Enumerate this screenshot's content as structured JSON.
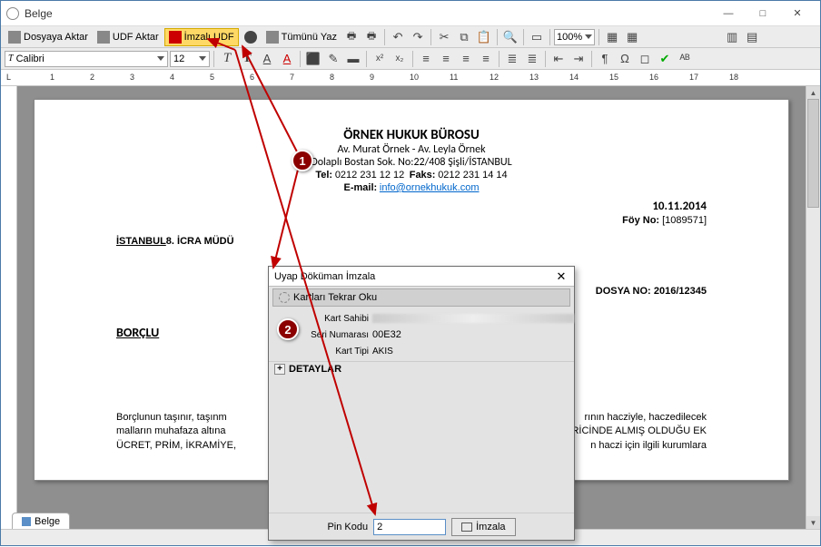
{
  "window": {
    "title": "Belge"
  },
  "toolbar": {
    "dosyaya_aktar": "Dosyaya Aktar",
    "udf_aktar": "UDF Aktar",
    "imzali_udf": "İmzalı UDF",
    "tumunu_yaz": "Tümünü Yaz",
    "zoom": "100%"
  },
  "font": {
    "name": "Calibri",
    "size": "12"
  },
  "doc": {
    "header": {
      "firm": "ÖRNEK HUKUK BÜROSU",
      "lawyers": "Av. Murat Örnek - Av. Leyla Örnek",
      "address": "Dolaplı Bostan Sok. No:22/408 Şişli/İSTANBUL",
      "tel_label": "Tel:",
      "tel": "0212 231 12 12",
      "fax_label": "Faks:",
      "fax": "0212 231 14 14",
      "email_label": "E-mail:",
      "email": "info@ornekhukuk.com"
    },
    "date": "10.11.2014",
    "foy_label": "Föy No:",
    "foy_no": "[1089571]",
    "court_pre": "İSTANBUL",
    "court_rest": "8. İCRA MÜDÜ",
    "dosya_label": "DOSYA NO:",
    "dosya_no": "2016/12345",
    "borclu": "BORÇLU",
    "body_l": "Borçlunun taşınır, taşınm",
    "body_r1": "rının hacziyle, haczedilecek",
    "body_l2": "malların muhafaza altına",
    "body_r2": "RİCİNDE ALMIŞ OLDUĞU EK",
    "body_l3": "ÜCRET, PRİM, İKRAMİYE,",
    "body_r3": "n haczi için ilgili kurumlara"
  },
  "dialog": {
    "title": "Uyap Döküman İmzala",
    "reread": "Kartları Tekrar Oku",
    "owner_label": "Kart Sahibi",
    "serial_label": "Seri Numarası",
    "serial_value": "00E32",
    "type_label": "Kart Tipi",
    "type_value": "AKIS",
    "details": "DETAYLAR",
    "pin_label": "Pin Kodu",
    "pin_value": "2",
    "sign": "İmzala"
  },
  "tab": {
    "label": "Belge"
  },
  "callouts": {
    "c1": "1",
    "c2": "2"
  },
  "ruler": [
    "1",
    "2",
    "3",
    "4",
    "5",
    "6",
    "7",
    "8",
    "9",
    "10",
    "11",
    "12",
    "13",
    "14",
    "15",
    "16",
    "17",
    "18"
  ]
}
